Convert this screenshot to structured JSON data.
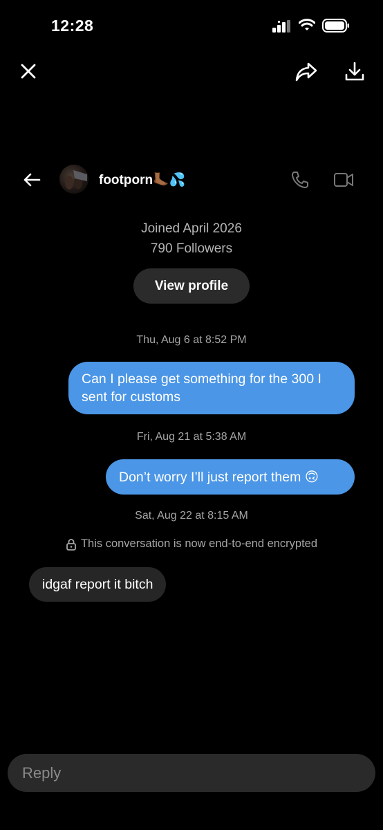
{
  "status_bar": {
    "time": "12:28"
  },
  "top_bar": {
    "icons": [
      "close-icon",
      "share-icon",
      "download-icon"
    ]
  },
  "header": {
    "username": "footporn🦶🏾💦",
    "icons": [
      "back-arrow-icon",
      "phone-icon",
      "video-icon"
    ]
  },
  "profile": {
    "joined": "Joined April 2026",
    "followers": "790 Followers",
    "view_profile_label": "View profile"
  },
  "messages": [
    {
      "timestamp": "Thu, Aug 6 at 8:52 PM",
      "direction": "outgoing",
      "text": "Can I please get something for the 300 I sent for customs"
    },
    {
      "timestamp": "Fri, Aug 21 at 5:38 AM",
      "direction": "outgoing",
      "text": "Don’t worry I’ll just report them 🙃"
    },
    {
      "timestamp": "Sat, Aug 22 at 8:15 AM",
      "direction": "incoming",
      "text": "idgaf report it bitch"
    }
  ],
  "encryption_notice": "This conversation is now end-to-end encrypted",
  "composer": {
    "placeholder": "Reply"
  },
  "colors": {
    "outgoing_bubble": "#4b96e6",
    "incoming_bubble": "#262626",
    "background": "#000000"
  }
}
